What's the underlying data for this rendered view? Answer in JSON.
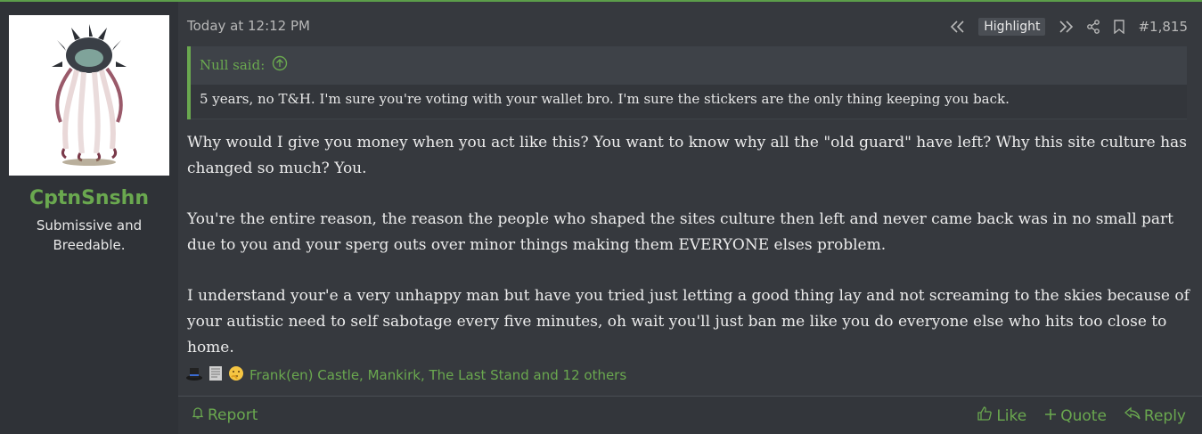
{
  "user": {
    "username": "CptnSnshn",
    "title": "Submissive and Breedable."
  },
  "post": {
    "timestamp": "Today at 12:12 PM",
    "highlight_label": "Highlight",
    "post_number": "#1,815",
    "quote": {
      "author": "Null said:",
      "text": "5 years, no T&H. I'm sure you're voting with your wallet bro. I'm sure the stickers are the only thing keeping you back."
    },
    "paragraphs": [
      "Why would I give you money when you act like this? You want to know why all the \"old guard\" have left? Why this site culture has changed so much? You.",
      "You're the entire reason, the reason the people who shaped the sites culture then left and never came back was in no small part due to you and your sperg outs over minor things making them EVERYONE elses problem.",
      "I understand your'e a very unhappy man but have you tried just letting a good thing lay and not screaming to the skies because of your autistic need to self sabotage every five minutes, oh wait you'll just ban me like you do everyone else who hits too close to home."
    ],
    "reactions_text": "Frank(en) Castle, Mankirk, The Last Stand and 12 others"
  },
  "footer": {
    "report": "Report",
    "like": "Like",
    "quote": "Quote",
    "reply": "Reply"
  },
  "colors": {
    "accent": "#6aa84f",
    "background": "#36393e"
  }
}
